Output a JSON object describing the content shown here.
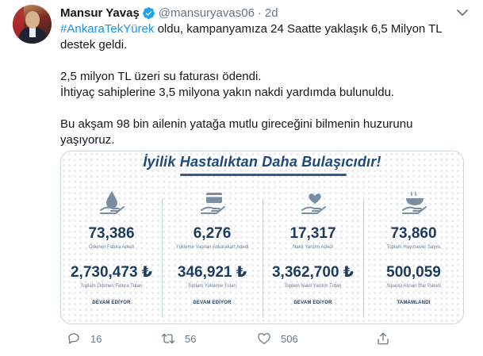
{
  "tweet": {
    "author_name": "Mansur Yavaş",
    "handle": "@mansuryavas06",
    "separator": "·",
    "time": "2d",
    "hashtag": "#AnkaraTekYürek",
    "line1_rest": " oldu, kampanyamıza 24 Saatte yaklaşık 6,5 Milyon TL destek geldi.",
    "line2": "2,5 milyon TL üzeri su faturası ödendi.",
    "line3": "İhtiyaç sahiplerine 3,5 milyona yakın nakdi yardımda bulunuldu.",
    "line4": "Bu akşam 98 bin ailenin yatağa mutlu gireceğini bilmenin huzurunu yaşıyoruz."
  },
  "infographic": {
    "title": "İyilik Hastalıktan Daha Bulaşıcıdır!",
    "accent": "#1e4a7a",
    "columns": [
      {
        "icon": "water-drop-icon",
        "value1": "73,386",
        "label1": "Ödenen Fatura Adedi",
        "value2": "2,730,473 ₺",
        "label2": "Toplam Ödenen Fatura Tutarı",
        "status": "DEVAM EDİYOR"
      },
      {
        "icon": "card-in-hand-icon",
        "value1": "6,276",
        "label1": "Yükleme Yapılan Ankarakart Adedi",
        "value2": "346,921 ₺",
        "label2": "Toplam Yükleme Tutarı",
        "status": "DEVAM EDİYOR"
      },
      {
        "icon": "heart-in-hand-icon",
        "value1": "17,317",
        "label1": "Nakit Yardım Adedi",
        "value2": "3,362,700 ₺",
        "label2": "Toplam Nakit Yardım Tutarı",
        "status": "DEVAM EDİYOR"
      },
      {
        "icon": "food-bowl-icon",
        "value1": "73,860",
        "label1": "Toplam Hayırsever Sayısı",
        "value2": "500,059",
        "label2": "Siparişi Alınan İftar Paketi",
        "status": "TAMAMLANDI"
      }
    ]
  },
  "actions": {
    "replies": "16",
    "retweets": "56",
    "likes": "506"
  },
  "colors": {
    "link": "#1b95e0",
    "verified": "#1da1f2",
    "muted": "#657786",
    "text": "#14171a"
  }
}
